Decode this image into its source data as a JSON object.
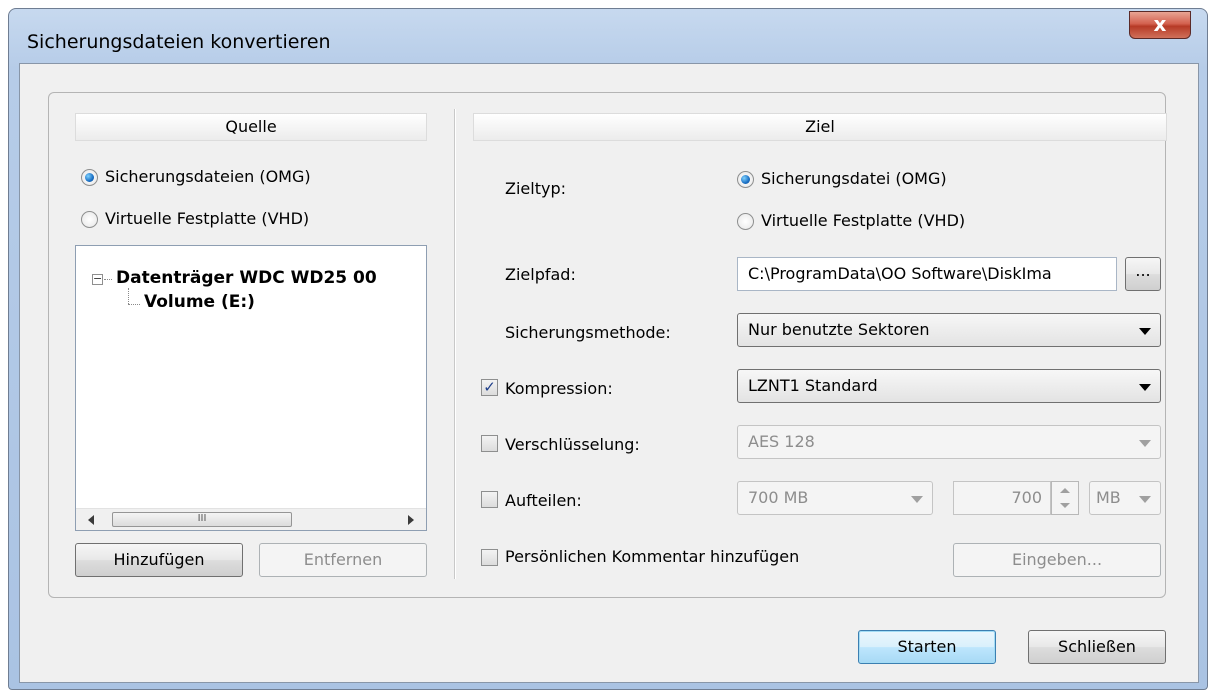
{
  "window": {
    "title": "Sicherungsdateien konvertieren",
    "close_label": "x"
  },
  "source": {
    "header": "Quelle",
    "radio_omg": {
      "label": "Sicherungsdateien (OMG)",
      "selected": true
    },
    "radio_vhd": {
      "label": "Virtuelle Festplatte (VHD)",
      "selected": false
    },
    "tree": {
      "disk": {
        "label": "Datenträger WDC WD25 00",
        "expander": "−"
      },
      "volume": {
        "label": "Volume (E:)"
      }
    },
    "scroll_thumb_label": "III",
    "add_button": "Hinzufügen",
    "remove_button": "Entfernen"
  },
  "target": {
    "header": "Ziel",
    "type_label": "Zieltyp:",
    "type_omg": {
      "label": "Sicherungsdatei (OMG)",
      "selected": true
    },
    "type_vhd": {
      "label": "Virtuelle Festplatte (VHD)",
      "selected": false
    },
    "path_label": "Zielpfad:",
    "path_value": "C:\\ProgramData\\OO Software\\DiskIma",
    "browse_button": "...",
    "method_label": "Sicherungsmethode:",
    "method_value": "Nur benutzte Sektoren",
    "compression": {
      "label": "Kompression:",
      "checked": true,
      "check_glyph": "✓",
      "value": "LZNT1 Standard"
    },
    "encryption": {
      "label": "Verschlüsselung:",
      "checked": false,
      "value": "AES 128"
    },
    "split": {
      "label": "Aufteilen:",
      "checked": false,
      "preset": "700 MB",
      "size": "700",
      "unit": "MB"
    },
    "comment": {
      "label": "Persönlichen Kommentar hinzufügen",
      "checked": false,
      "button": "Eingeben..."
    }
  },
  "footer": {
    "start_button": "Starten",
    "close_button": "Schließen"
  },
  "colors": {
    "title_bar": "#b6cce8",
    "close_button": "#c9483a",
    "default_button": "#bee6fd",
    "radio_selected": "#1a6fc4"
  }
}
